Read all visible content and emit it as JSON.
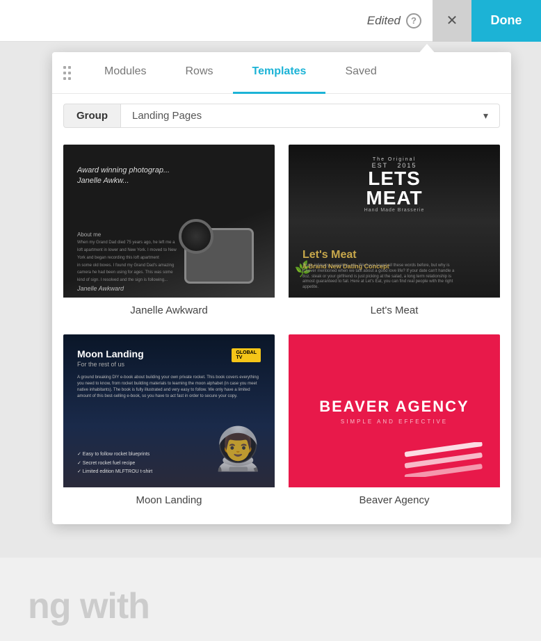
{
  "topbar": {
    "edited_label": "Edited",
    "help_icon": "?",
    "close_label": "✕",
    "done_label": "Done"
  },
  "panel": {
    "nav_tabs": [
      {
        "id": "modules",
        "label": "Modules",
        "active": false
      },
      {
        "id": "rows",
        "label": "Rows",
        "active": false
      },
      {
        "id": "templates",
        "label": "Templates",
        "active": true
      },
      {
        "id": "saved",
        "label": "Saved",
        "active": false
      }
    ],
    "filter": {
      "group_label": "Group",
      "landing_pages_label": "Landing Pages",
      "dropdown_arrow": "▾"
    },
    "templates": [
      {
        "id": "janelle-awkward",
        "name": "Janelle Awkward",
        "thumb_type": "janelle"
      },
      {
        "id": "lets-meat",
        "name": "Let's Meat",
        "thumb_type": "letsmeat"
      },
      {
        "id": "moon-landing",
        "name": "Moon Landing",
        "thumb_type": "moonlanding"
      },
      {
        "id": "beaver-agency",
        "name": "Beaver Agency",
        "thumb_type": "beaver"
      }
    ]
  },
  "background": {
    "text": "ng with"
  }
}
